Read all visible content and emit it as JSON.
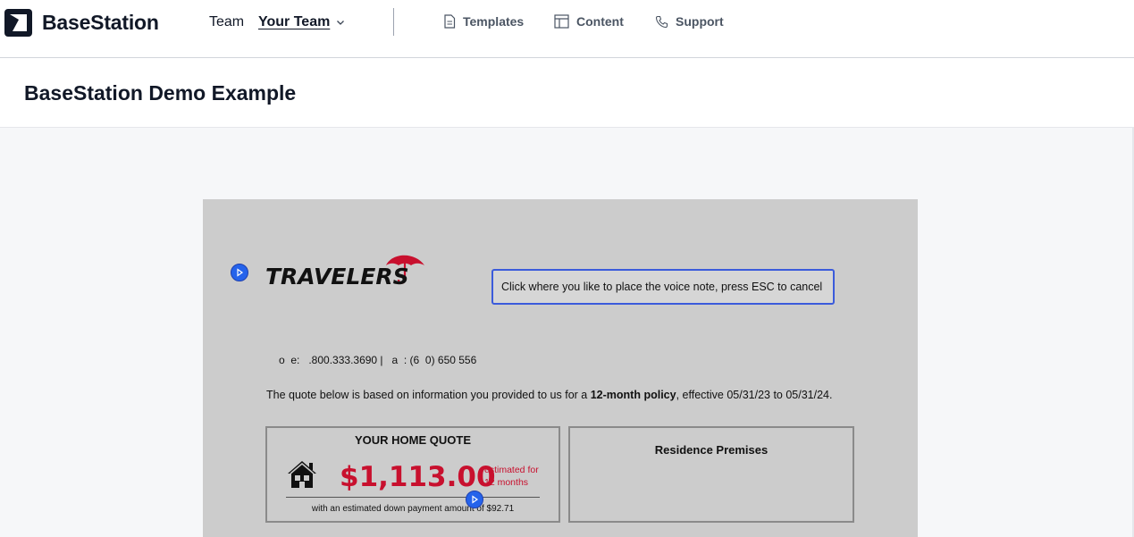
{
  "app": {
    "name": "BaseStation"
  },
  "header": {
    "team_label": "Team",
    "team_value": "Your Team",
    "nav": [
      {
        "label": "Templates",
        "icon": "document-icon"
      },
      {
        "label": "Content",
        "icon": "layout-icon"
      },
      {
        "label": "Support",
        "icon": "phone-icon"
      }
    ]
  },
  "page": {
    "title": "BaseStation Demo Example"
  },
  "document": {
    "brand": "TRAVELERS",
    "tooltip": "Click where you like to place the voice note, press ESC to cancel",
    "contact": "o  e:   .800.333.3690 |   a  : (6  0) 650 556",
    "quote_intro": "The quote below is based on information you provided to us for a ",
    "quote_bold": "12-month policy",
    "quote_rest": ", effective 05/31/23 to 05/31/24.",
    "home_quote": {
      "title": "YOUR HOME QUOTE",
      "price": "$1,113.00",
      "estimated_line1": "estimated for",
      "estimated_line2": "12 months",
      "down_payment": "with an estimated down payment amount of $92.71"
    },
    "residence": {
      "title": "Residence Premises"
    }
  },
  "colors": {
    "brand_red": "#c8102e",
    "accent_blue": "#2563eb",
    "doc_background": "#cccccc"
  }
}
